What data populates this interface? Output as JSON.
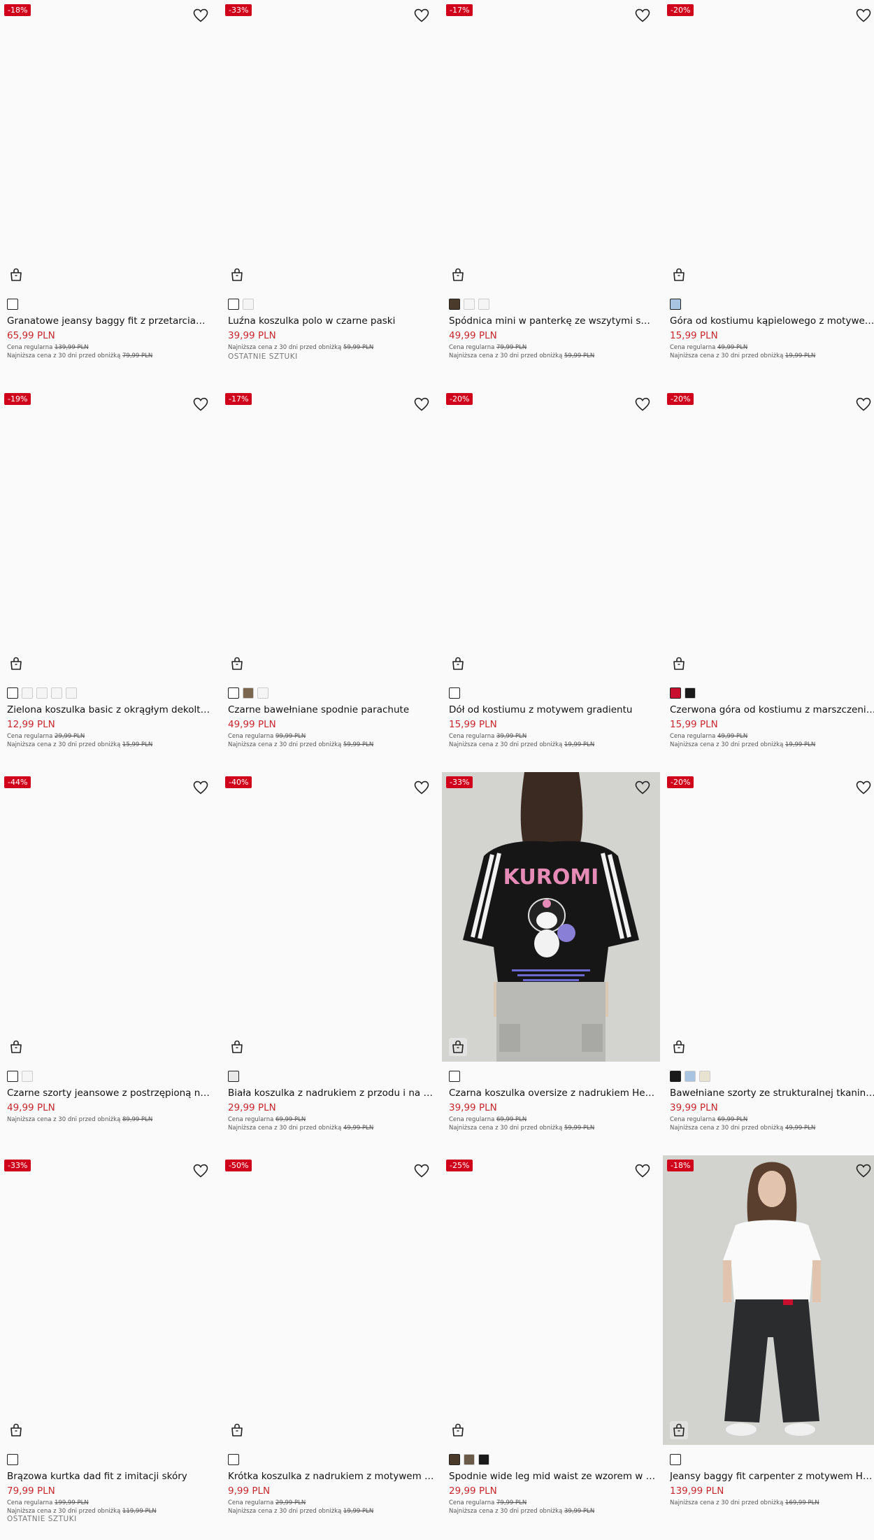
{
  "colors": {
    "badge_bg": "#d0021b",
    "price": "#c8272e",
    "background": "#fafafa"
  },
  "labels": {
    "regular_price": "Cena regularna",
    "lowest_price": "Najniższa cena z 30 dni przed obniżką",
    "last_items": "OSTATNIE SZTUKI"
  },
  "products": [
    {
      "discount": "-18%",
      "name": "Granatowe jeansy baggy fit z przetarciami na kolanach",
      "price": "65,99 PLN",
      "regular_price": "139,99 PLN",
      "lowest_price": "79,99 PLN",
      "swatches": [
        "#ffffff"
      ],
      "last_items": false,
      "image": null
    },
    {
      "discount": "-33%",
      "name": "Luźna koszulka polo w czarne paski",
      "price": "39,99 PLN",
      "regular_price": null,
      "lowest_price": "59,99 PLN",
      "swatches": [
        "#ffffff",
        "#f5f5f5"
      ],
      "last_items": true,
      "image": null
    },
    {
      "discount": "-17%",
      "name": "Spódnica mini w panterkę ze wszytymi spodenkami",
      "price": "49,99 PLN",
      "regular_price": "79,99 PLN",
      "lowest_price": "59,99 PLN",
      "swatches": [
        "#4a3a2a",
        "#f5f5f5",
        "#f5f5f5"
      ],
      "last_items": false,
      "image": null
    },
    {
      "discount": "-20%",
      "name": "Góra od kostiumu kąpielowego z motywem gradientu",
      "price": "15,99 PLN",
      "regular_price": "49,99 PLN",
      "lowest_price": "19,99 PLN",
      "swatches": [
        "#a9c4e0"
      ],
      "last_items": false,
      "image": null
    },
    {
      "discount": "-19%",
      "name": "Zielona koszulka basic z okrągłym dekoltem",
      "price": "12,99 PLN",
      "regular_price": "29,99 PLN",
      "lowest_price": "15,99 PLN",
      "swatches": [
        "#ffffff",
        "#f5f5f5",
        "#f5f5f5",
        "#f5f5f5",
        "#f5f5f5"
      ],
      "last_items": false,
      "image": null
    },
    {
      "discount": "-17%",
      "name": "Czarne bawełniane spodnie parachute",
      "price": "49,99 PLN",
      "regular_price": "99,99 PLN",
      "lowest_price": "59,99 PLN",
      "swatches": [
        "#ffffff",
        "#7b6650",
        "#f5f5f5"
      ],
      "last_items": false,
      "image": null
    },
    {
      "discount": "-20%",
      "name": "Dół od kostiumu z motywem gradientu",
      "price": "15,99 PLN",
      "regular_price": "39,99 PLN",
      "lowest_price": "19,99 PLN",
      "swatches": [
        "#ffffff"
      ],
      "last_items": false,
      "image": null
    },
    {
      "discount": "-20%",
      "name": "Czerwona góra od kostiumu z marszczeniami",
      "price": "15,99 PLN",
      "regular_price": "49,99 PLN",
      "lowest_price": "19,99 PLN",
      "swatches": [
        "#c8102e",
        "#1a1a1a"
      ],
      "last_items": false,
      "image": null
    },
    {
      "discount": "-44%",
      "name": "Czarne szorty jeansowe z postrzępioną nogawką",
      "price": "49,99 PLN",
      "regular_price": null,
      "lowest_price": "89,99 PLN",
      "swatches": [
        "#ffffff",
        "#f5f5f5"
      ],
      "last_items": false,
      "image": null
    },
    {
      "discount": "-40%",
      "name": "Biała koszulka z nadrukiem z przodu i na plecach",
      "price": "29,99 PLN",
      "regular_price": "69,99 PLN",
      "lowest_price": "49,99 PLN",
      "swatches": [
        "#e8e8e8"
      ],
      "last_items": false,
      "image": null
    },
    {
      "discount": "-33%",
      "name": "Czarna koszulka oversize z nadrukiem Hello Kitty Kuromi",
      "price": "39,99 PLN",
      "regular_price": "69,99 PLN",
      "lowest_price": "59,99 PLN",
      "swatches": [
        "#ffffff"
      ],
      "last_items": false,
      "image": "kuromi-shirt"
    },
    {
      "discount": "-20%",
      "name": "Bawełniane szorty ze strukturalnej tkaniny cargo",
      "price": "39,99 PLN",
      "regular_price": "69,99 PLN",
      "lowest_price": "49,99 PLN",
      "swatches": [
        "#1a1a1a",
        "#a9c4e0",
        "#e8e2d0"
      ],
      "last_items": false,
      "image": null
    },
    {
      "discount": "-33%",
      "name": "Brązowa kurtka dad fit z imitacji skóry",
      "price": "79,99 PLN",
      "regular_price": "199,99 PLN",
      "lowest_price": "119,99 PLN",
      "swatches": [
        "#ffffff"
      ],
      "last_items": true,
      "image": null
    },
    {
      "discount": "-50%",
      "name": "Krótka koszulka z nadrukiem z motywem kociaka",
      "price": "9,99 PLN",
      "regular_price": "29,99 PLN",
      "lowest_price": "19,99 PLN",
      "swatches": [
        "#ffffff"
      ],
      "last_items": false,
      "image": null
    },
    {
      "discount": "-25%",
      "name": "Spodnie wide leg mid waist ze wzorem w panterkę",
      "price": "29,99 PLN",
      "regular_price": "79,99 PLN",
      "lowest_price": "39,99 PLN",
      "swatches": [
        "#4a3a2a",
        "#6b5a48",
        "#1a1a1a"
      ],
      "last_items": false,
      "image": null
    },
    {
      "discount": "-18%",
      "name": "Jeansy baggy fit carpenter z motywem Hello Kitty",
      "price": "139,99 PLN",
      "regular_price": null,
      "lowest_price": "169,99 PLN",
      "swatches": [
        "#ffffff"
      ],
      "last_items": false,
      "image": "jeans-model"
    }
  ]
}
